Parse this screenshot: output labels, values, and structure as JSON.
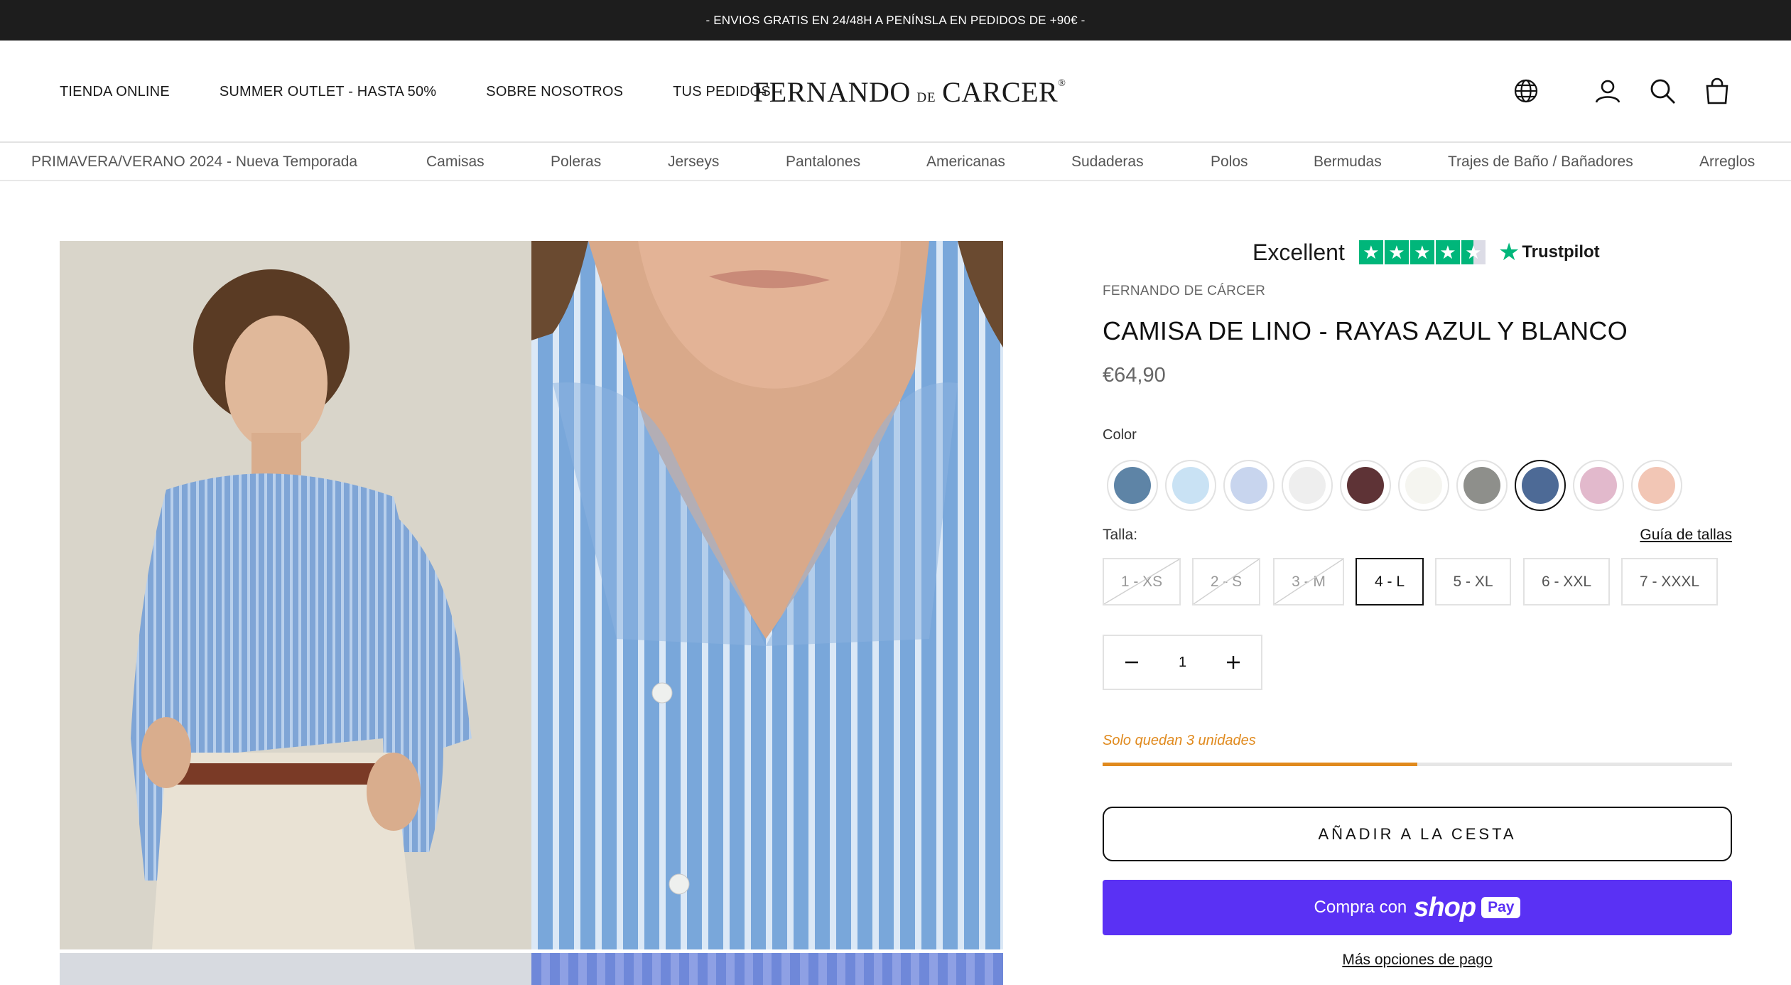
{
  "announcement": "- ENVIOS GRATIS EN 24/48H A PENÍNSLA EN PEDIDOS DE +90€ -",
  "header": {
    "nav": [
      "TIENDA ONLINE",
      "SUMMER OUTLET - HASTA 50%",
      "SOBRE NOSOTROS",
      "TUS PEDIDOS"
    ],
    "logo": {
      "main1": "FERNANDO",
      "de": "DE",
      "main2": "CARCER",
      "reg": "®"
    },
    "icons": [
      "globe-icon",
      "account-icon",
      "search-icon",
      "cart-bag-icon"
    ]
  },
  "categories": [
    "PRIMAVERA/VERANO 2024 - Nueva Temporada",
    "Camisas",
    "Poleras",
    "Jerseys",
    "Pantalones",
    "Americanas",
    "Sudaderas",
    "Polos",
    "Bermudas",
    "Trajes de Baño / Bañadores",
    "Arreglos"
  ],
  "trustpilot": {
    "rating_text": "Excellent",
    "stars": 4.5,
    "brand": "Trustpilot",
    "brand_color": "#00b67a"
  },
  "product": {
    "vendor": "FERNANDO DE CÁRCER",
    "title": "CAMISA DE LINO - RAYAS AZUL Y BLANCO",
    "price": "€64,90",
    "color_label": "Color",
    "swatches": [
      {
        "color": "#5e84a6",
        "selected": false
      },
      {
        "color": "#c9e2f4",
        "selected": false
      },
      {
        "color": "#c8d5ee",
        "selected": false
      },
      {
        "color": "#eeeeee",
        "selected": false
      },
      {
        "color": "#5e3336",
        "selected": false
      },
      {
        "color": "#f5f5f0",
        "selected": false
      },
      {
        "color": "#8e8f8b",
        "selected": false
      },
      {
        "color": "#4d6a96",
        "selected": true
      },
      {
        "color": "#e2b9cc",
        "selected": false
      },
      {
        "color": "#f2c6b5",
        "selected": false
      }
    ],
    "size_label": "Talla:",
    "size_guide": "Guía de tallas",
    "sizes": [
      {
        "label": "1 - XS",
        "sold_out": true,
        "selected": false
      },
      {
        "label": "2 - S",
        "sold_out": true,
        "selected": false
      },
      {
        "label": "3 - M",
        "sold_out": true,
        "selected": false
      },
      {
        "label": "4 - L",
        "sold_out": false,
        "selected": true
      },
      {
        "label": "5 - XL",
        "sold_out": false,
        "selected": false
      },
      {
        "label": "6 - XXL",
        "sold_out": false,
        "selected": false
      },
      {
        "label": "7 - XXXL",
        "sold_out": false,
        "selected": false
      }
    ],
    "quantity": "1",
    "stock_message": "Solo quedan 3 unidades",
    "stock_level": 0.5,
    "stock_color": "#e08a1e",
    "add_to_cart": "AÑADIR A LA CESTA",
    "shop_pay": {
      "prefix": "Compra con",
      "shop": "shop",
      "pay": "Pay",
      "color": "#5a31f4"
    },
    "more_options": "Más opciones de pago"
  }
}
